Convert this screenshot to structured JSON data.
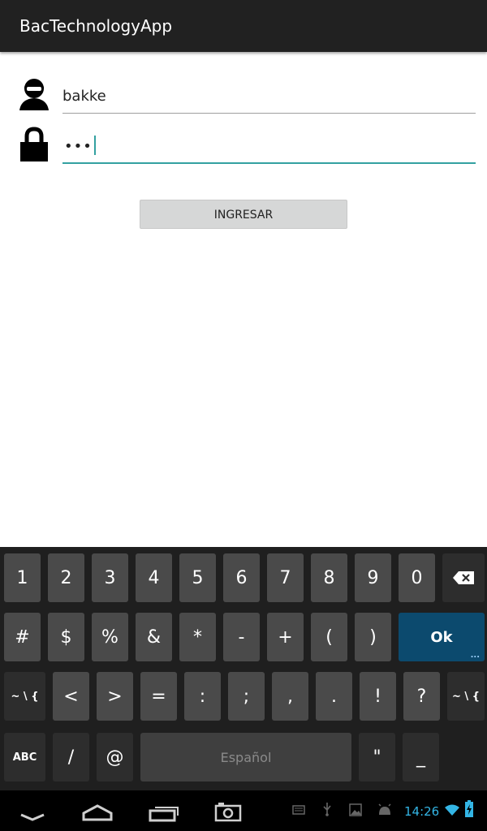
{
  "app": {
    "title": "BacTechnologyApp"
  },
  "login": {
    "username_value": "bakke",
    "password_masked": "•••",
    "submit_label": "INGRESAR"
  },
  "keyboard": {
    "row1": [
      "1",
      "2",
      "3",
      "4",
      "5",
      "6",
      "7",
      "8",
      "9",
      "0"
    ],
    "row2": [
      "#",
      "$",
      "%",
      "&",
      "*",
      "-",
      "+",
      "(",
      ")"
    ],
    "ok_label": "Ok",
    "ok_hint": "...",
    "row3_edge_left": "~ \\ {",
    "row3": [
      "<",
      ">",
      "=",
      ":",
      ";",
      ",",
      ".",
      "!",
      "?"
    ],
    "row3_edge_right": "~ \\ {",
    "abc_label": "ABC",
    "slash": "/",
    "at": "@",
    "space_label": "Español",
    "quote": "\"",
    "underscore": "_"
  },
  "status": {
    "time": "14:26",
    "accent_color": "#33b5e5",
    "icons": [
      "keyboard-icon",
      "usb-icon",
      "image-icon",
      "android-icon",
      "wifi-icon",
      "battery-icon"
    ]
  },
  "nav": {
    "icons": [
      "back-icon",
      "home-icon",
      "recent-apps-icon",
      "screenshot-icon"
    ]
  }
}
